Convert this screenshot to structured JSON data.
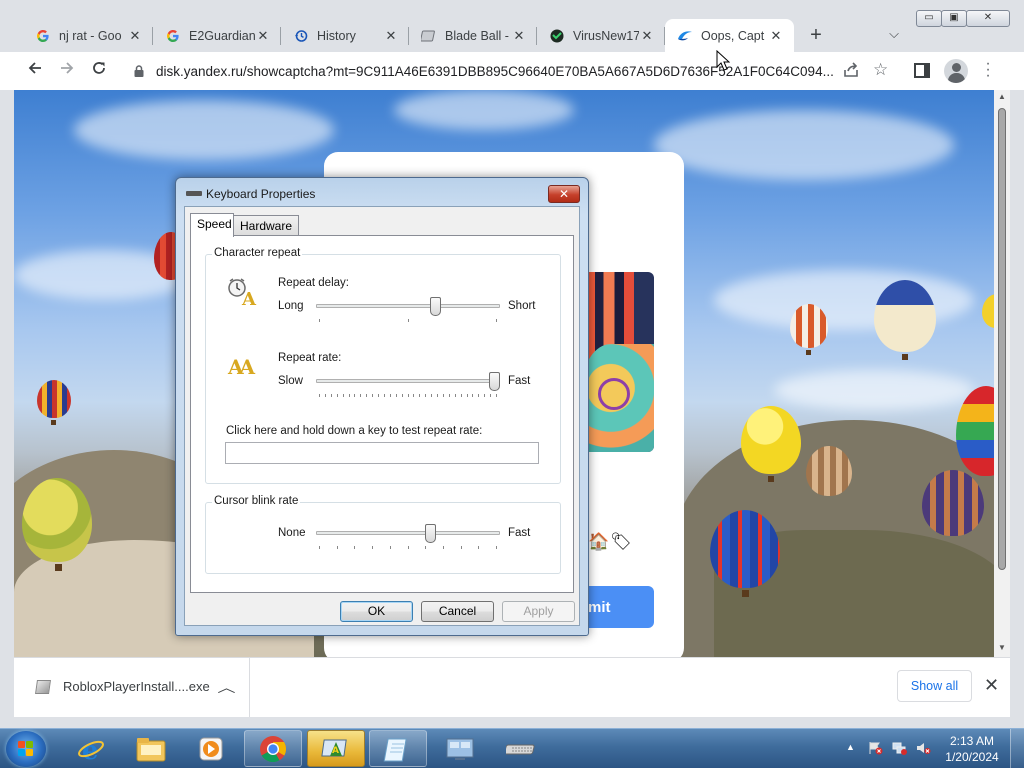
{
  "browser": {
    "tabs": [
      {
        "title": "nj rat - Goo",
        "favicon": "google-g-icon"
      },
      {
        "title": "E2Guardian",
        "favicon": "google-g-icon"
      },
      {
        "title": "History",
        "favicon": "history-clock-icon"
      },
      {
        "title": "Blade Ball -",
        "favicon": "roblox-page-icon"
      },
      {
        "title": "VirusNew17",
        "favicon": "virusnew-icon"
      },
      {
        "title": "Oops, Capt",
        "favicon": "yandex-disk-icon",
        "active": true
      }
    ],
    "new_tab_symbol": "+",
    "url": "disk.yandex.ru/showcaptcha?mt=9C911A46E6391DBB895C96640E70BA5A667A5D6D7636F52A1F0C64C094...",
    "window_controls": {
      "minimize": "▭",
      "maximize": "▣",
      "close": "✕"
    }
  },
  "page": {
    "submit_label": "mit",
    "help_symbol": "?",
    "captcha_icons": "🏠🏷"
  },
  "downloads": {
    "file_name": "RobloxPlayerInstall....exe",
    "show_all_label": "Show all",
    "close_symbol": "✕"
  },
  "dialog": {
    "title": "Keyboard Properties",
    "close_symbol": "✕",
    "tabs": [
      "Speed",
      "Hardware"
    ],
    "active_tab": "Speed",
    "character_repeat": {
      "group_label": "Character repeat",
      "repeat_delay": {
        "label": "Repeat delay:",
        "min_label": "Long",
        "max_label": "Short",
        "value": 0.66
      },
      "repeat_rate": {
        "label": "Repeat rate:",
        "min_label": "Slow",
        "max_label": "Fast",
        "value": 1.0
      },
      "test_label": "Click here and hold down a key to test repeat rate:",
      "test_value": ""
    },
    "cursor_blink": {
      "group_label": "Cursor blink rate",
      "min_label": "None",
      "max_label": "Fast",
      "value": 0.63
    },
    "buttons": {
      "ok": "OK",
      "cancel": "Cancel",
      "apply": "Apply"
    }
  },
  "taskbar": {
    "pinned": [
      "internet-explorer-icon",
      "file-explorer-icon",
      "media-player-icon",
      "chrome-icon",
      "control-panel-icon",
      "notepad-icon",
      "display-settings-icon",
      "keyboard-icon"
    ],
    "clock_time": "2:13 AM",
    "clock_date": "1/20/2024"
  },
  "colors": {
    "accent": "#4b8ff5",
    "link_blue": "#1a73e8",
    "taskbar": "#3f6c9c"
  }
}
